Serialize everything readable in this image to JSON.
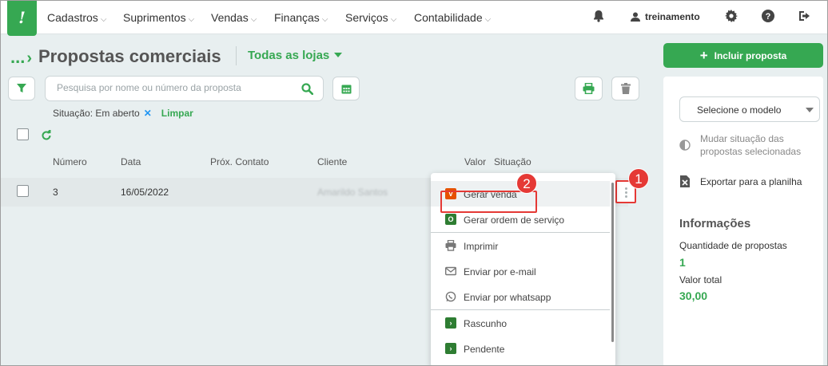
{
  "nav": {
    "logo": "!",
    "items": [
      "Cadastros",
      "Suprimentos",
      "Vendas",
      "Finanças",
      "Serviços",
      "Contabilidade"
    ],
    "user": "treinamento"
  },
  "header": {
    "breadcrumb": "...",
    "title": "Propostas comerciais",
    "store_select": "Todas as lojas"
  },
  "search": {
    "placeholder": "Pesquisa por nome ou número da proposta"
  },
  "filter": {
    "label": "Situação: Em aberto",
    "remove": "✕",
    "clear": "Limpar"
  },
  "table": {
    "columns": [
      "Número",
      "Data",
      "Próx. Contato",
      "Cliente",
      "Valor",
      "Situação"
    ],
    "rows": [
      {
        "numero": "3",
        "data": "16/05/2022",
        "prox_contato": "",
        "cliente": "Amarildo Santos"
      }
    ]
  },
  "menu": {
    "items": [
      {
        "label": "Gerar venda",
        "icon": "V",
        "color": "#e65100"
      },
      {
        "label": "Gerar ordem de serviço",
        "icon": "O",
        "color": "#2e7d32"
      },
      {
        "label": "Imprimir",
        "icon": "printer-icon"
      },
      {
        "label": "Enviar por e-mail",
        "icon": "envelope-icon"
      },
      {
        "label": "Enviar por whatsapp",
        "icon": "whatsapp-icon"
      },
      {
        "label": "Rascunho",
        "icon": "arrow-right-icon",
        "color": "#2e7d32"
      },
      {
        "label": "Pendente",
        "icon": "arrow-right-icon",
        "color": "#2e7d32"
      }
    ]
  },
  "callouts": [
    "1",
    "2"
  ],
  "sidebar": {
    "include_button": "Incluir proposta",
    "model_select": "Selecione o modelo",
    "change_status": "Mudar situação das propostas selecionadas",
    "export": "Exportar para a planilha",
    "info_title": "Informações",
    "qty_label": "Quantidade de propostas",
    "qty_value": "1",
    "total_label": "Valor total",
    "total_value": "30,00"
  },
  "colors": {
    "brand": "#36a852",
    "callout": "#e53935",
    "page_bg": "#e8eff0"
  }
}
